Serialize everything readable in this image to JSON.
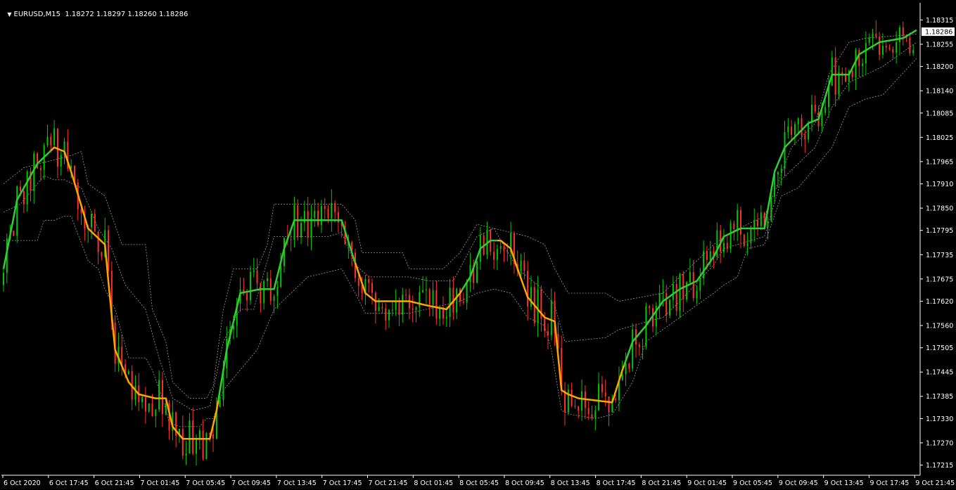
{
  "header": {
    "symbol": "EURUSD,M15",
    "ohlc": "1.18272 1.18297 1.18260 1.18286"
  },
  "colors": {
    "background": "#000000",
    "axis": "#ffffff",
    "bull_candle": "#00c800",
    "bear_candle": "#ff3030",
    "trend_up": "#32cd32",
    "trend_down": "#ffa500",
    "band": "#9a9a9a",
    "price_label_bg": "#ffffff",
    "price_label_text": "#000000"
  },
  "chart_data": {
    "type": "candlestick",
    "symbol": "EURUSD",
    "timeframe": "M15",
    "ylim": [
      1.1719,
      1.1834
    ],
    "current_price": "1.18286",
    "y_ticks": [
      "1.18315",
      "1.18255",
      "1.18200",
      "1.18140",
      "1.18085",
      "1.18025",
      "1.17965",
      "1.17910",
      "1.17850",
      "1.17795",
      "1.17735",
      "1.17675",
      "1.17620",
      "1.17560",
      "1.17505",
      "1.17445",
      "1.17385",
      "1.17330",
      "1.17270",
      "1.17215"
    ],
    "x_ticks": [
      "6 Oct 2020",
      "6 Oct 17:45",
      "6 Oct 21:45",
      "7 Oct 01:45",
      "7 Oct 05:45",
      "7 Oct 09:45",
      "7 Oct 13:45",
      "7 Oct 17:45",
      "7 Oct 21:45",
      "8 Oct 01:45",
      "8 Oct 05:45",
      "8 Oct 09:45",
      "8 Oct 13:45",
      "8 Oct 17:45",
      "8 Oct 21:45",
      "9 Oct 01:45",
      "9 Oct 05:45",
      "9 Oct 09:45",
      "9 Oct 13:45",
      "9 Oct 17:45",
      "9 Oct 21:45"
    ],
    "trend_line": {
      "points": [
        [
          0,
          1.177
        ],
        [
          4,
          1.1787
        ],
        [
          10,
          1.1796
        ],
        [
          15,
          1.18
        ],
        [
          18,
          1.1799
        ],
        [
          20,
          1.1794
        ],
        [
          25,
          1.178
        ],
        [
          30,
          1.1776
        ],
        [
          31,
          1.1767
        ],
        [
          33,
          1.175
        ],
        [
          37,
          1.1742
        ],
        [
          40,
          1.1739
        ],
        [
          45,
          1.1738
        ],
        [
          48,
          1.1738
        ],
        [
          50,
          1.1731
        ],
        [
          53,
          1.1728
        ],
        [
          57,
          1.1728
        ],
        [
          61,
          1.1728
        ],
        [
          63,
          1.1735
        ],
        [
          66,
          1.175
        ],
        [
          70,
          1.1764
        ],
        [
          76,
          1.1765
        ],
        [
          80,
          1.1765
        ],
        [
          83,
          1.1775
        ],
        [
          86,
          1.1782
        ],
        [
          94,
          1.1782
        ],
        [
          100,
          1.1782
        ],
        [
          103,
          1.1774
        ],
        [
          107,
          1.1764
        ],
        [
          110,
          1.1762
        ],
        [
          120,
          1.1762
        ],
        [
          125,
          1.1761
        ],
        [
          131,
          1.176
        ],
        [
          135,
          1.1764
        ],
        [
          138,
          1.1768
        ],
        [
          141,
          1.1775
        ],
        [
          144,
          1.1777
        ],
        [
          147,
          1.1777
        ],
        [
          150,
          1.1775
        ],
        [
          152,
          1.177
        ],
        [
          155,
          1.1763
        ],
        [
          160,
          1.1758
        ],
        [
          163,
          1.1757
        ],
        [
          165,
          1.174
        ],
        [
          167,
          1.1739
        ],
        [
          170,
          1.1738
        ],
        [
          180,
          1.1737
        ],
        [
          183,
          1.1745
        ],
        [
          186,
          1.1752
        ],
        [
          190,
          1.1756
        ],
        [
          195,
          1.1762
        ],
        [
          200,
          1.1765
        ],
        [
          205,
          1.1767
        ],
        [
          210,
          1.1773
        ],
        [
          213,
          1.1778
        ],
        [
          218,
          1.178
        ],
        [
          225,
          1.178
        ],
        [
          228,
          1.1794
        ],
        [
          231,
          1.18
        ],
        [
          238,
          1.1806
        ],
        [
          241,
          1.1807
        ],
        [
          245,
          1.1818
        ],
        [
          250,
          1.1818
        ],
        [
          253,
          1.1823
        ],
        [
          259,
          1.1826
        ],
        [
          266,
          1.1827
        ],
        [
          270,
          1.1829
        ]
      ],
      "down_ranges": [
        [
          14,
          63
        ],
        [
          104,
          135
        ],
        [
          146,
          183
        ]
      ]
    },
    "upper_band": [
      [
        0,
        1.1791
      ],
      [
        6,
        1.1795
      ],
      [
        20,
        1.1798
      ],
      [
        23,
        1.1799
      ],
      [
        25,
        1.1791
      ],
      [
        30,
        1.1788
      ],
      [
        35,
        1.1776
      ],
      [
        42,
        1.1776
      ],
      [
        44,
        1.176
      ],
      [
        48,
        1.1752
      ],
      [
        50,
        1.1742
      ],
      [
        55,
        1.1738
      ],
      [
        60,
        1.1738
      ],
      [
        62,
        1.1741
      ],
      [
        65,
        1.176
      ],
      [
        68,
        1.177
      ],
      [
        75,
        1.177
      ],
      [
        78,
        1.1776
      ],
      [
        80,
        1.1786
      ],
      [
        100,
        1.1786
      ],
      [
        104,
        1.1782
      ],
      [
        106,
        1.1774
      ],
      [
        118,
        1.1774
      ],
      [
        120,
        1.177
      ],
      [
        130,
        1.177
      ],
      [
        135,
        1.1774
      ],
      [
        140,
        1.1781
      ],
      [
        155,
        1.1778
      ],
      [
        160,
        1.1776
      ],
      [
        163,
        1.177
      ],
      [
        167,
        1.1764
      ],
      [
        178,
        1.1764
      ],
      [
        182,
        1.1762
      ],
      [
        195,
        1.1764
      ],
      [
        200,
        1.1768
      ],
      [
        210,
        1.1776
      ],
      [
        215,
        1.1779
      ],
      [
        225,
        1.1783
      ],
      [
        228,
        1.1789
      ],
      [
        233,
        1.18
      ],
      [
        240,
        1.1806
      ],
      [
        244,
        1.1818
      ],
      [
        250,
        1.1826
      ],
      [
        255,
        1.1827
      ],
      [
        270,
        1.1828
      ]
    ],
    "lower_band": [
      [
        0,
        1.1777
      ],
      [
        5,
        1.1777
      ],
      [
        10,
        1.1777
      ],
      [
        12,
        1.1782
      ],
      [
        15,
        1.1782
      ],
      [
        18,
        1.1783
      ],
      [
        20,
        1.1783
      ],
      [
        25,
        1.1772
      ],
      [
        28,
        1.177
      ],
      [
        30,
        1.1765
      ],
      [
        33,
        1.176
      ],
      [
        37,
        1.1748
      ],
      [
        42,
        1.1748
      ],
      [
        44,
        1.1745
      ],
      [
        47,
        1.1738
      ],
      [
        49,
        1.1732
      ],
      [
        52,
        1.1731
      ],
      [
        58,
        1.1731
      ],
      [
        60,
        1.1733
      ],
      [
        62,
        1.1733
      ],
      [
        65,
        1.174
      ],
      [
        70,
        1.1745
      ],
      [
        75,
        1.175
      ],
      [
        80,
        1.176
      ],
      [
        85,
        1.1764
      ],
      [
        90,
        1.1768
      ],
      [
        100,
        1.177
      ],
      [
        104,
        1.1764
      ],
      [
        107,
        1.1759
      ],
      [
        120,
        1.1759
      ],
      [
        125,
        1.176
      ],
      [
        130,
        1.1761
      ],
      [
        135,
        1.1762
      ],
      [
        140,
        1.1764
      ],
      [
        145,
        1.1765
      ],
      [
        150,
        1.1764
      ],
      [
        155,
        1.1758
      ],
      [
        160,
        1.1756
      ],
      [
        162,
        1.175
      ],
      [
        165,
        1.1735
      ],
      [
        168,
        1.1734
      ],
      [
        175,
        1.1733
      ],
      [
        180,
        1.1734
      ],
      [
        183,
        1.1738
      ],
      [
        186,
        1.1742
      ],
      [
        190,
        1.1752
      ],
      [
        195,
        1.1755
      ],
      [
        200,
        1.1758
      ],
      [
        205,
        1.1761
      ],
      [
        210,
        1.1764
      ],
      [
        213,
        1.1766
      ],
      [
        217,
        1.1768
      ],
      [
        220,
        1.1775
      ],
      [
        225,
        1.1776
      ],
      [
        230,
        1.1788
      ],
      [
        235,
        1.179
      ],
      [
        240,
        1.1795
      ],
      [
        245,
        1.18
      ],
      [
        250,
        1.181
      ],
      [
        255,
        1.1812
      ],
      [
        260,
        1.1813
      ],
      [
        270,
        1.1822
      ]
    ],
    "inner_upper_band": [
      [
        0,
        1.1784
      ],
      [
        5,
        1.1786
      ],
      [
        12,
        1.1793
      ],
      [
        15,
        1.1792
      ],
      [
        18,
        1.1792
      ],
      [
        23,
        1.179
      ],
      [
        28,
        1.178
      ],
      [
        32,
        1.1775
      ],
      [
        36,
        1.1766
      ],
      [
        42,
        1.176
      ],
      [
        46,
        1.1748
      ],
      [
        50,
        1.1738
      ],
      [
        56,
        1.1735
      ],
      [
        61,
        1.1736
      ],
      [
        65,
        1.1752
      ],
      [
        70,
        1.176
      ],
      [
        74,
        1.176
      ],
      [
        80,
        1.1778
      ],
      [
        96,
        1.1778
      ],
      [
        100,
        1.1779
      ],
      [
        104,
        1.1771
      ],
      [
        108,
        1.1768
      ],
      [
        120,
        1.1768
      ],
      [
        126,
        1.1767
      ],
      [
        133,
        1.1767
      ],
      [
        140,
        1.1778
      ],
      [
        145,
        1.178
      ],
      [
        152,
        1.177
      ],
      [
        158,
        1.1766
      ],
      [
        163,
        1.1761
      ],
      [
        166,
        1.1752
      ],
      [
        178,
        1.1753
      ],
      [
        182,
        1.1755
      ],
      [
        195,
        1.1758
      ],
      [
        200,
        1.1762
      ],
      [
        210,
        1.1771
      ],
      [
        213,
        1.1775
      ],
      [
        225,
        1.1778
      ],
      [
        230,
        1.1792
      ],
      [
        240,
        1.18
      ],
      [
        245,
        1.181
      ],
      [
        250,
        1.1816
      ],
      [
        260,
        1.182
      ],
      [
        270,
        1.1826
      ]
    ],
    "candles_seed": 20201006
  }
}
